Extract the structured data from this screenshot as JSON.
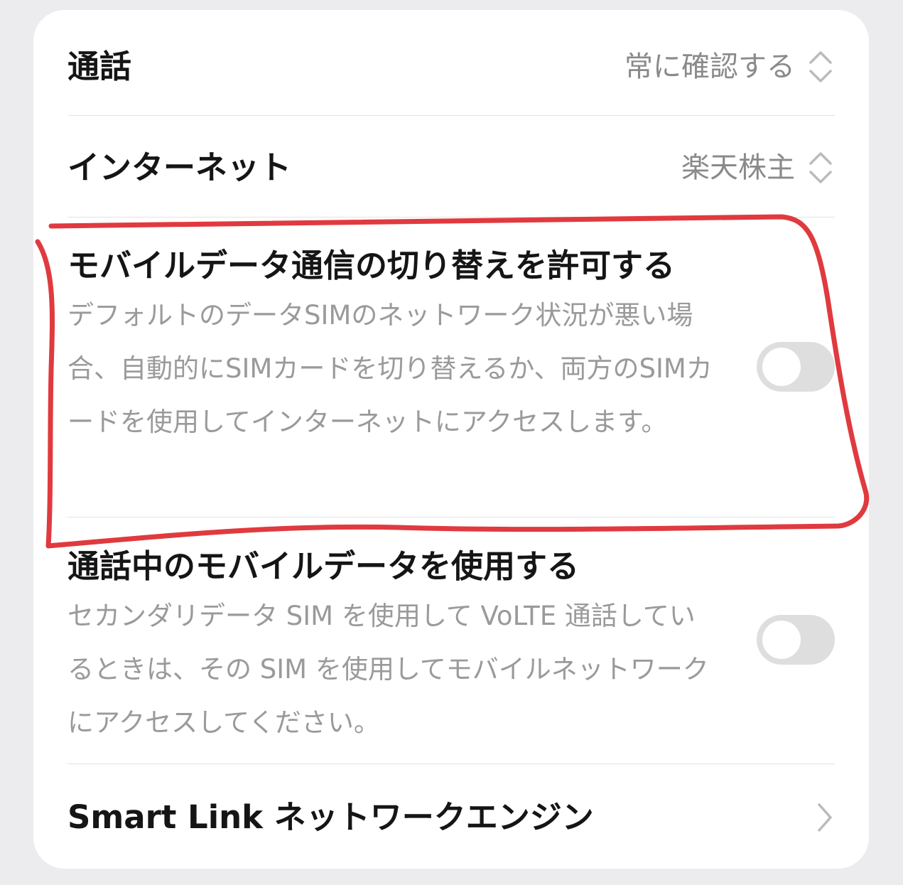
{
  "rows": [
    {
      "title": "通話",
      "value": "常に確認する",
      "control_icon": "updown-chevron-icon"
    },
    {
      "title": "インターネット",
      "value": "楽天株主",
      "control_icon": "updown-chevron-icon"
    },
    {
      "title": "モバイルデータ通信の切り替えを許可する",
      "description": "デフォルトのデータSIMのネットワーク状況が悪い場合、自動的にSIMカードを切り替えるか、両方のSIMカードを使用してインターネットにアクセスします。",
      "toggle_on": false
    },
    {
      "title": "通話中のモバイルデータを使用する",
      "description": "セカンダリデータ SIM を使用して VoLTE 通話しているときは、その SIM を使用してモバイルネットワークにアクセスしてください。",
      "toggle_on": false
    },
    {
      "title": "Smart Link ネットワークエンジン",
      "control_icon": "chevron-right-icon"
    }
  ],
  "colors": {
    "background": "#ececef",
    "card": "#ffffff",
    "title": "#151515",
    "secondary_text": "#8a8a8a",
    "toggle_off": "#dedede",
    "annotation": "#e03a3f"
  }
}
